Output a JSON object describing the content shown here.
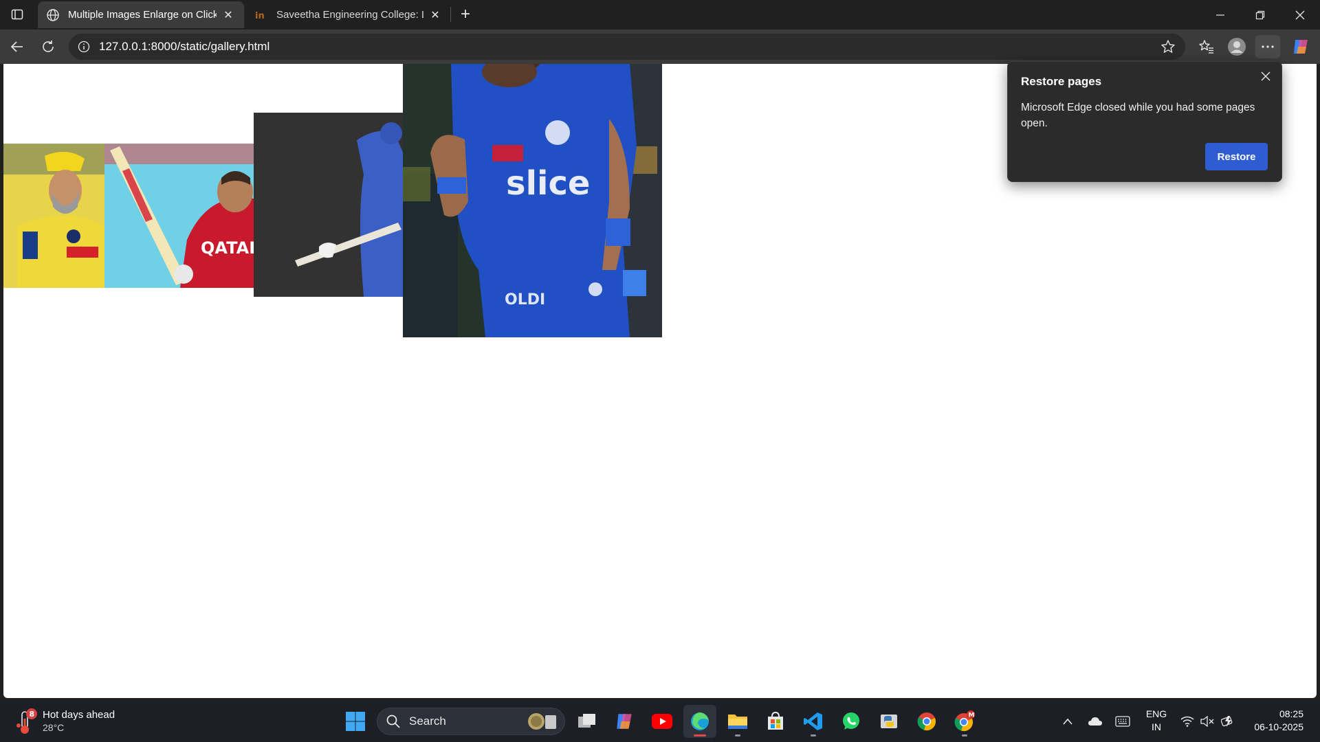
{
  "browser": {
    "tabs": [
      {
        "title": "Multiple Images Enlarge on Click",
        "active": true
      },
      {
        "title": "Saveetha Engineering College: Lo",
        "active": false
      }
    ],
    "url": "127.0.0.1:8000/static/gallery.html"
  },
  "page": {
    "images": [
      {
        "label": "dhoni-photo"
      },
      {
        "label": "kohli-photo"
      },
      {
        "label": "rohit-photo"
      },
      {
        "label": "hardik-photo"
      }
    ]
  },
  "popup": {
    "title": "Restore pages",
    "body": "Microsoft Edge closed while you had some pages open.",
    "button": "Restore"
  },
  "taskbar": {
    "weather_title": "Hot days ahead",
    "weather_temp": "28°C",
    "weather_badge": "8",
    "search_placeholder": "Search",
    "lang_top": "ENG",
    "lang_bottom": "IN",
    "time": "08:25",
    "date": "06-10-2025"
  },
  "colors": {
    "accent": "#2d5dd0",
    "chrome_dark": "#202020",
    "chrome_mid": "#3b3b3b",
    "taskbar": "#1c1f26"
  }
}
